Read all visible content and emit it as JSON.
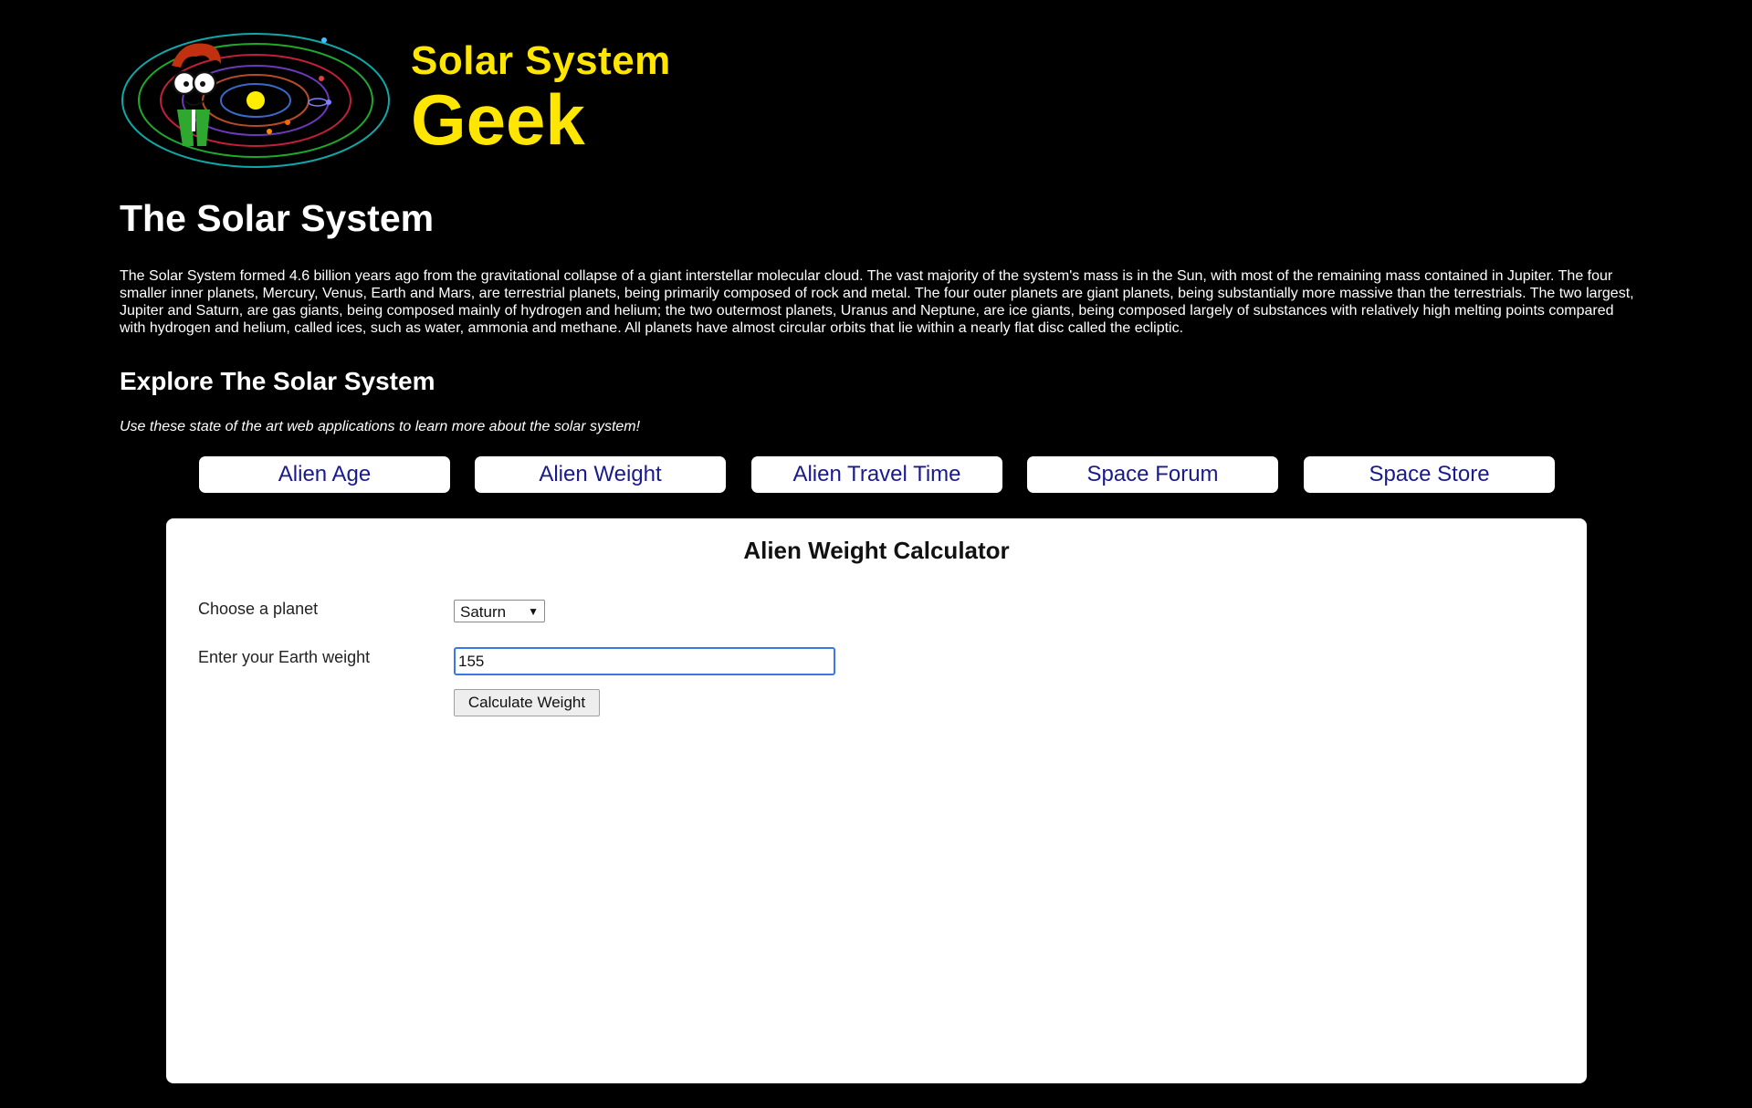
{
  "brand": {
    "line1": "Solar System",
    "line2": "Geek",
    "color": "#ffe600",
    "logo_icon": "solar-system-geek-logo"
  },
  "page_title": "The Solar System",
  "intro": "The Solar System formed 4.6 billion years ago from the gravitational collapse of a giant interstellar molecular cloud. The vast majority of the system's mass is in the Sun, with most of the remaining mass contained in Jupiter. The four smaller inner planets, Mercury, Venus, Earth and Mars, are terrestrial planets, being primarily composed of rock and metal. The four outer planets are giant planets, being substantially more massive than the terrestrials. The two largest, Jupiter and Saturn, are gas giants, being composed mainly of hydrogen and helium; the two outermost planets, Uranus and Neptune, are ice giants, being composed largely of substances with relatively high melting points compared with hydrogen and helium, called ices, such as water, ammonia and methane. All planets have almost circular orbits that lie within a nearly flat disc called the ecliptic.",
  "explore": {
    "title": "Explore The Solar System",
    "tagline": "Use these state of the art web applications to learn more about the solar system!"
  },
  "nav": {
    "link_color": "#1a1a8c",
    "items": [
      {
        "label": "Alien Age"
      },
      {
        "label": "Alien Weight"
      },
      {
        "label": "Alien Travel Time"
      },
      {
        "label": "Space Forum"
      },
      {
        "label": "Space Store"
      }
    ]
  },
  "calculator": {
    "title": "Alien Weight Calculator",
    "planet_label": "Choose a planet",
    "planet_value": "Saturn",
    "weight_label": "Enter your Earth weight",
    "weight_value": "155",
    "button_label": "Calculate Weight"
  }
}
